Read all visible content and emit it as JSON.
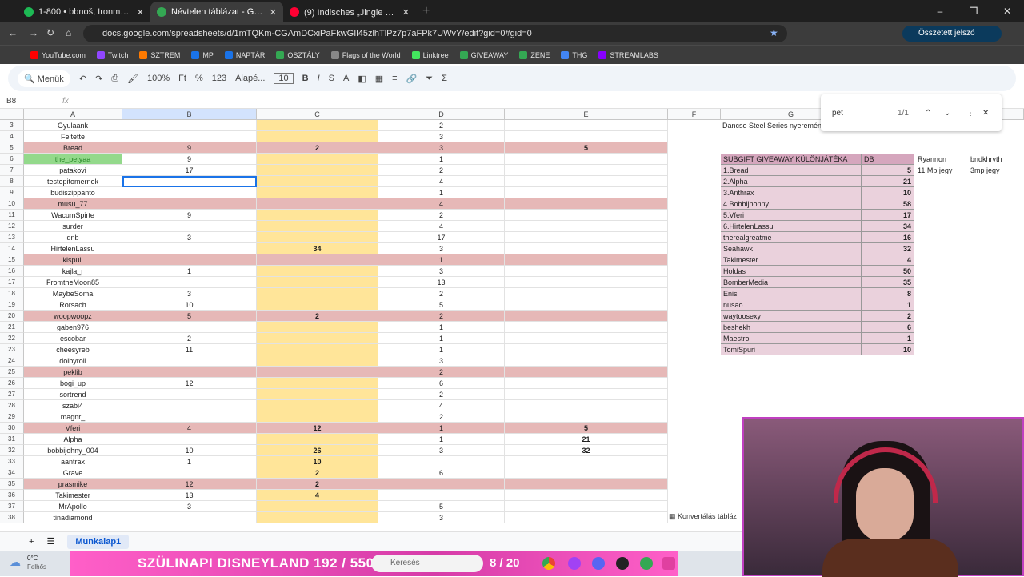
{
  "browser": {
    "tabs": [
      {
        "title": "1-800 • bbnoš, Ironmouse",
        "color": "#1db954"
      },
      {
        "title": "Névtelen táblázat - Google Tábl",
        "color": "#34a853",
        "active": true
      },
      {
        "title": "(9) Indisches „Jingle Bells” 😂 -",
        "color": "#ff0033"
      }
    ],
    "url": "docs.google.com/spreadsheets/d/1mTQKm-CGAmDCxiPaFkwGIl45zlhTlPz7p7aFPk7UWvY/edit?gid=0#gid=0",
    "password_button": "Összetett jelszó megadása",
    "bookmarks": [
      "YouTube.com",
      "Twitch",
      "SZTREM",
      "MP",
      "NAPTÁR",
      "OSZTÁLY",
      "Flags of the World",
      "Linktree",
      "GIVEAWAY",
      "ZENE",
      "THG",
      "STREAMLABS"
    ]
  },
  "toolbar": {
    "menus": "Menük",
    "zoom": "100%",
    "font": "Alapé...",
    "size": "10",
    "fmt": "123",
    "pct": "%",
    "ft": "Ft"
  },
  "cell_ref": "B8",
  "find": {
    "query": "pet",
    "count": "1/1"
  },
  "columns": [
    "A",
    "B",
    "C",
    "D",
    "E",
    "F",
    "G"
  ],
  "rows": [
    {
      "n": "3",
      "a": "Gyulaank",
      "b": "",
      "c": "",
      "d": "2",
      "e": "",
      "pink": false
    },
    {
      "n": "4",
      "a": "Feltette",
      "b": "",
      "c": "",
      "d": "3",
      "e": "",
      "pink": false
    },
    {
      "n": "5",
      "a": "Bread",
      "b": "9",
      "c": "2",
      "d": "3",
      "e": "5",
      "pink": true
    },
    {
      "n": "6",
      "a": "the_petyaa",
      "b": "9",
      "c": "",
      "d": "1",
      "e": "",
      "pink": false,
      "green": true
    },
    {
      "n": "7",
      "a": "patakovi",
      "b": "17",
      "c": "",
      "d": "2",
      "e": "",
      "pink": false
    },
    {
      "n": "8",
      "a": "testepitomernok",
      "b": "",
      "c": "",
      "d": "4",
      "e": "",
      "pink": false
    },
    {
      "n": "9",
      "a": "budiszippanto",
      "b": "",
      "c": "",
      "d": "1",
      "e": "",
      "pink": false
    },
    {
      "n": "10",
      "a": "musu_77",
      "b": "",
      "c": "",
      "d": "4",
      "e": "",
      "pink": true
    },
    {
      "n": "11",
      "a": "WacumSpirte",
      "b": "9",
      "c": "",
      "d": "2",
      "e": "",
      "pink": false
    },
    {
      "n": "12",
      "a": "surder",
      "b": "",
      "c": "",
      "d": "4",
      "e": "",
      "pink": false
    },
    {
      "n": "13",
      "a": "dnb",
      "b": "3",
      "c": "",
      "d": "17",
      "e": "",
      "pink": false
    },
    {
      "n": "14",
      "a": "HirtelenLassu",
      "b": "",
      "c": "34",
      "d": "3",
      "e": "",
      "pink": false
    },
    {
      "n": "15",
      "a": "kispuli",
      "b": "",
      "c": "",
      "d": "1",
      "e": "",
      "pink": true
    },
    {
      "n": "16",
      "a": "kajla_r",
      "b": "1",
      "c": "",
      "d": "3",
      "e": "",
      "pink": false
    },
    {
      "n": "17",
      "a": "FromtheMoon85",
      "b": "",
      "c": "",
      "d": "13",
      "e": "",
      "pink": false
    },
    {
      "n": "18",
      "a": "MaybeSoma",
      "b": "3",
      "c": "",
      "d": "2",
      "e": "",
      "pink": false
    },
    {
      "n": "19",
      "a": "Rorsach",
      "b": "10",
      "c": "",
      "d": "5",
      "e": "",
      "pink": false
    },
    {
      "n": "20",
      "a": "woopwoopz",
      "b": "5",
      "c": "2",
      "d": "2",
      "e": "",
      "pink": true
    },
    {
      "n": "21",
      "a": "gaben976",
      "b": "",
      "c": "",
      "d": "1",
      "e": "",
      "pink": false
    },
    {
      "n": "22",
      "a": "escobar",
      "b": "2",
      "c": "",
      "d": "1",
      "e": "",
      "pink": false
    },
    {
      "n": "23",
      "a": "cheesyreb",
      "b": "11",
      "c": "",
      "d": "1",
      "e": "",
      "pink": false
    },
    {
      "n": "24",
      "a": "dolbyroll",
      "b": "",
      "c": "",
      "d": "3",
      "e": "",
      "pink": false
    },
    {
      "n": "25",
      "a": "peklib",
      "b": "",
      "c": "",
      "d": "2",
      "e": "",
      "pink": true
    },
    {
      "n": "26",
      "a": "bogi_up",
      "b": "12",
      "c": "",
      "d": "6",
      "e": "",
      "pink": false
    },
    {
      "n": "27",
      "a": "sortrend",
      "b": "",
      "c": "",
      "d": "2",
      "e": "",
      "pink": false
    },
    {
      "n": "28",
      "a": "szabi4",
      "b": "",
      "c": "",
      "d": "4",
      "e": "",
      "pink": false
    },
    {
      "n": "29",
      "a": "magnr_",
      "b": "",
      "c": "",
      "d": "2",
      "e": "",
      "pink": false
    },
    {
      "n": "30",
      "a": "Vferi",
      "b": "4",
      "c": "12",
      "d": "1",
      "e": "5",
      "pink": true
    },
    {
      "n": "31",
      "a": "Alpha",
      "b": "",
      "c": "",
      "d": "1",
      "e": "21",
      "pink": false
    },
    {
      "n": "32",
      "a": "bobbijohny_004",
      "b": "10",
      "c": "26",
      "d": "3",
      "e": "32",
      "pink": false
    },
    {
      "n": "33",
      "a": "aantrax",
      "b": "1",
      "c": "10",
      "d": "",
      "e": "",
      "pink": false
    },
    {
      "n": "34",
      "a": "Grave",
      "b": "",
      "c": "2",
      "d": "6",
      "e": "",
      "pink": false
    },
    {
      "n": "35",
      "a": "prasmike",
      "b": "12",
      "c": "2",
      "d": "",
      "e": "",
      "pink": true
    },
    {
      "n": "36",
      "a": "Takimester",
      "b": "13",
      "c": "4",
      "d": "",
      "e": "",
      "pink": false
    },
    {
      "n": "37",
      "a": "MrApollo",
      "b": "3",
      "c": "",
      "d": "5",
      "e": "",
      "pink": false
    },
    {
      "n": "38",
      "a": "tinadiamond",
      "b": "",
      "c": "",
      "d": "3",
      "e": "",
      "pink": false
    }
  ],
  "side": {
    "note": "Dancso Steel Series nyeremén",
    "header": "SUBGIFT GIVEAWAY KÜLÖNJÁTÉKA",
    "header_db": "DB",
    "extra1_a": "Ryannon",
    "extra1_b": "bndkhrvth",
    "extra2_a": "11 Mp jegy",
    "extra2_b": "3mp jegy",
    "items": [
      [
        "1.Bread",
        "5"
      ],
      [
        "2.Alpha",
        "21"
      ],
      [
        "3.Anthrax",
        "10"
      ],
      [
        "4.Bobbijhonny",
        "58"
      ],
      [
        "5.Vferi",
        "17"
      ],
      [
        "6.HirtelenLassu",
        "34"
      ],
      [
        "therealgreatme",
        "16"
      ],
      [
        "Seahawk",
        "32"
      ],
      [
        "Takimester",
        "4"
      ],
      [
        "Holdas",
        "50"
      ],
      [
        "BomberMedia",
        "35"
      ],
      [
        "Enis",
        "8"
      ],
      [
        "nusao",
        "1"
      ],
      [
        "waytoosexy",
        "2"
      ],
      [
        "beshekh",
        "6"
      ],
      [
        "Maestro",
        "1"
      ],
      [
        "TomiSpuri",
        "10"
      ]
    ]
  },
  "convert_label": "Konvertálás tábláz",
  "sheet_tab": "Munkalap1",
  "taskbar": {
    "temp": "0°C",
    "weather": "Felhős",
    "banner": "SZÜLINAPI DISNEYLAND 192 / 550",
    "counter": "8 / 20",
    "search": "Keresés"
  }
}
